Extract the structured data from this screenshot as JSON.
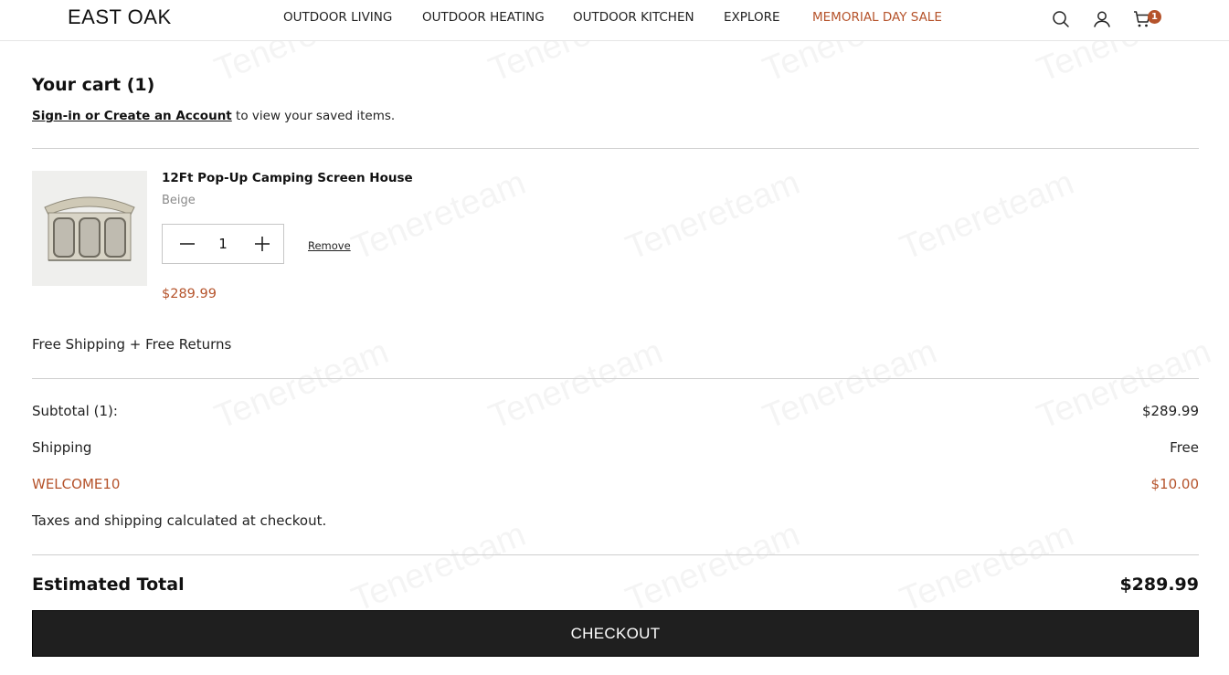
{
  "brand": {
    "logo": "EAST OAK"
  },
  "nav": {
    "items": [
      "OUTDOOR LIVING",
      "OUTDOOR HEATING",
      "OUTDOOR KITCHEN",
      "EXPLORE",
      "MEMORIAL DAY SALE"
    ]
  },
  "header_icons": {
    "search": "search-icon",
    "account": "user-icon",
    "cart": "cart-icon",
    "cart_count": "1"
  },
  "cart": {
    "title": "Your cart (1)",
    "signin_link": "Sign-in or Create an Account",
    "signin_suffix": " to view your saved items.",
    "item": {
      "name": "12Ft Pop-Up Camping Screen House",
      "variant": "Beige",
      "quantity": "1",
      "remove_label": "Remove",
      "price": "$289.99"
    },
    "free_shipping": "Free Shipping + Free Returns"
  },
  "summary": {
    "subtotal_label": "Subtotal (1):",
    "subtotal_value": "$289.99",
    "shipping_label": "Shipping",
    "shipping_value": "Free",
    "coupon_label": "WELCOME10",
    "coupon_value": "$10.00",
    "tax_note": "Taxes and shipping calculated at checkout.",
    "estimated_label": "Estimated Total",
    "estimated_value": "$289.99",
    "checkout_label": "CHECKOUT"
  },
  "watermark": "Tenereteam",
  "colors": {
    "accent": "#b5532b",
    "checkout_bg": "#1f1f1f",
    "divider": "#cfcfcf"
  }
}
